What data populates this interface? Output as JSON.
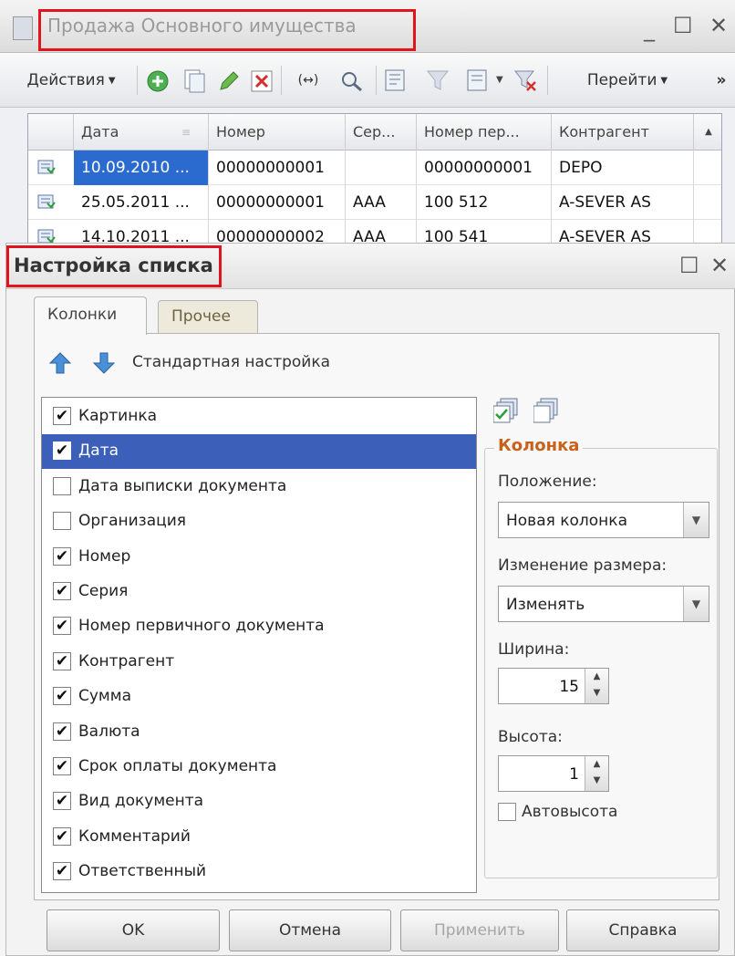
{
  "bg_window": {
    "title": "Продажа Основного имущества",
    "controls": {
      "minimize": "_",
      "maximize": "☐",
      "close": "✕"
    },
    "toolbar": {
      "actions_label": "Действия",
      "goto_label": "Перейти",
      "more_label": "»",
      "arrows_label": "(↔)"
    },
    "grid": {
      "columns": [
        "Дата",
        "Номер",
        "Сер...",
        "Номер пер...",
        "Контрагент"
      ],
      "rows": [
        [
          "10.09.2010 ...",
          "00000000001",
          "",
          "00000000001",
          "DEPO"
        ],
        [
          "25.05.2011 ...",
          "00000000001",
          "AAA",
          "100 512",
          "A-SEVER AS"
        ],
        [
          "14.10.2011 ...",
          "00000000002",
          "AAA",
          "100 541",
          "A-SEVER AS"
        ]
      ]
    }
  },
  "dialog": {
    "title": "Настройка списка",
    "controls": {
      "maximize": "☐",
      "close": "✕"
    },
    "tabs": [
      {
        "label": "Колонки",
        "active": true
      },
      {
        "label": "Прочее",
        "active": false
      }
    ],
    "standard_settings": "Стандартная настройка",
    "columns_list": [
      {
        "label": "Картинка",
        "checked": true
      },
      {
        "label": "Дата",
        "checked": true,
        "selected": true
      },
      {
        "label": "Дата выписки документа",
        "checked": false
      },
      {
        "label": "Организация",
        "checked": false
      },
      {
        "label": "Номер",
        "checked": true
      },
      {
        "label": "Серия",
        "checked": true
      },
      {
        "label": "Номер первичного документа",
        "checked": true
      },
      {
        "label": "Контрагент",
        "checked": true
      },
      {
        "label": "Сумма",
        "checked": true
      },
      {
        "label": "Валюта",
        "checked": true
      },
      {
        "label": "Срок оплаты документа",
        "checked": true
      },
      {
        "label": "Вид документа",
        "checked": true
      },
      {
        "label": "Комментарий",
        "checked": true
      },
      {
        "label": "Ответственный",
        "checked": true
      }
    ],
    "column_group": {
      "legend": "Колонка",
      "position_label": "Положение:",
      "position_value": "Новая колонка",
      "resize_label": "Изменение размера:",
      "resize_value": "Изменять",
      "width_label": "Ширина:",
      "width_value": "15",
      "height_label": "Высота:",
      "height_value": "1",
      "autoheight_label": "Автовысота",
      "autoheight_checked": false
    },
    "buttons": {
      "ok": "OK",
      "cancel": "Отмена",
      "apply": "Применить",
      "help": "Справка"
    }
  },
  "colors": {
    "highlight_red": "#e0141e",
    "selection_blue": "#3c5fb9",
    "grid_selection": "#2b6bd0",
    "group_legend": "#c8621a"
  }
}
